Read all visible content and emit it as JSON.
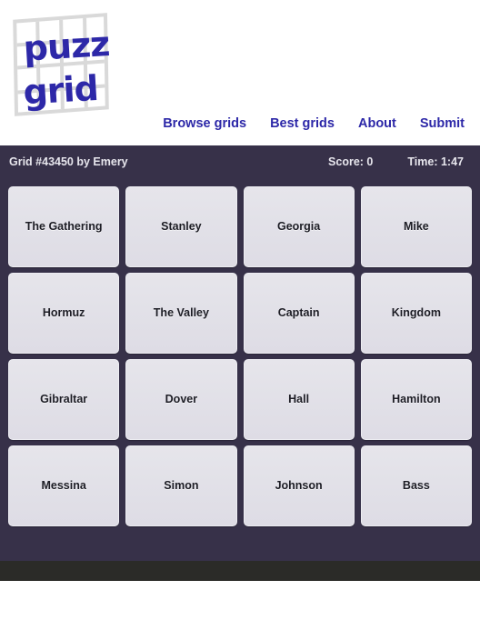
{
  "header": {
    "logo": {
      "line1": "puzz",
      "line2": "grid",
      "color": "#2d28a8"
    },
    "nav": [
      {
        "label": "Browse grids",
        "name": "nav-browse-grids"
      },
      {
        "label": "Best grids",
        "name": "nav-best-grids"
      },
      {
        "label": "About",
        "name": "nav-about"
      },
      {
        "label": "Submit",
        "name": "nav-submit"
      }
    ]
  },
  "info_bar": {
    "grid_title": "Grid #43450 by Emery",
    "score_label": "Score: 0",
    "time_label": "Time: 1:47",
    "background": "#373149",
    "text_color": "#e7e6ed"
  },
  "puzzle": {
    "rows": 4,
    "columns": 4,
    "cell_background": "#e2e1e8",
    "cells": [
      {
        "label": "The Gathering"
      },
      {
        "label": "Stanley"
      },
      {
        "label": "Georgia"
      },
      {
        "label": "Mike"
      },
      {
        "label": "Hormuz"
      },
      {
        "label": "The Valley"
      },
      {
        "label": "Captain"
      },
      {
        "label": "Kingdom"
      },
      {
        "label": "Gibraltar"
      },
      {
        "label": "Dover"
      },
      {
        "label": "Hall"
      },
      {
        "label": "Hamilton"
      },
      {
        "label": "Messina"
      },
      {
        "label": "Simon"
      },
      {
        "label": "Johnson"
      },
      {
        "label": "Bass"
      }
    ]
  },
  "footer": {
    "strip_color": "#2b2b28"
  }
}
